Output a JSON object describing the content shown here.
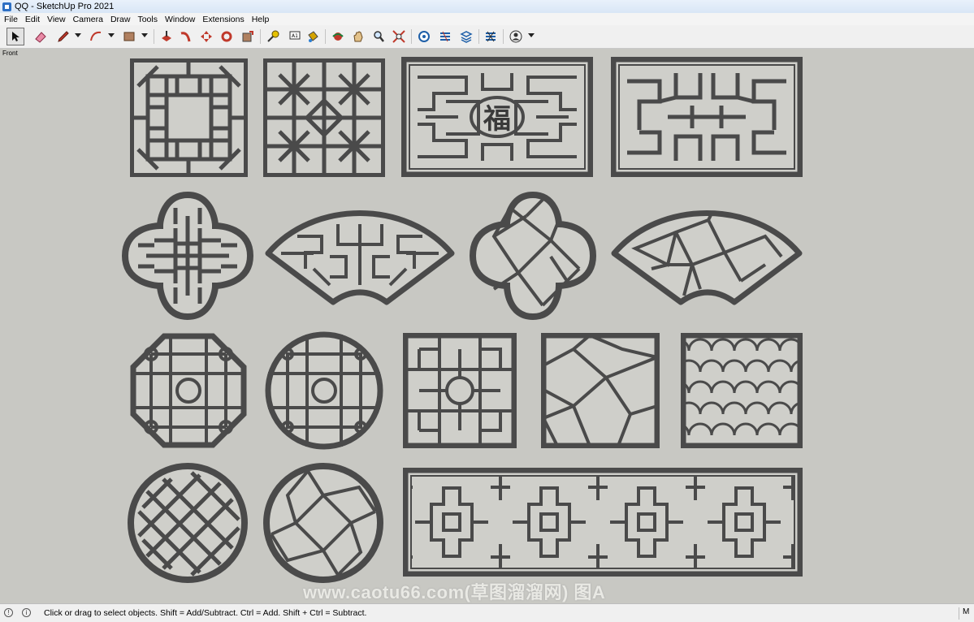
{
  "window": {
    "title": "QQ - SketchUp Pro 2021"
  },
  "menu": {
    "items": [
      "File",
      "Edit",
      "View",
      "Camera",
      "Draw",
      "Tools",
      "Window",
      "Extensions",
      "Help"
    ]
  },
  "toolbar": {
    "tools": [
      "select-tool",
      "eraser-tool",
      "line-tool",
      "arc-tool",
      "shape-tool",
      "push-pull-tool",
      "follow-me-tool",
      "move-tool",
      "rotate-tool",
      "scale-tool",
      "tape-measure-tool",
      "text-tool",
      "paint-bucket-tool",
      "orbit-tool",
      "pan-tool",
      "zoom-tool",
      "zoom-extents-tool",
      "warehouse-tool",
      "extension-warehouse-tool",
      "layout-tool",
      "extension-manager-tool",
      "account-tool"
    ]
  },
  "viewport": {
    "scene_label": "Front",
    "background": "#c8c8c3",
    "frame_color": "#4a4a4a",
    "infill_color": "#cfcfca",
    "panels": [
      "square-lattice-panel-1",
      "square-lattice-panel-2",
      "rect-fu-character-panel",
      "rect-lattice-panel",
      "quatrefoil-lattice-panel",
      "fan-lattice-panel",
      "quatrefoil-ice-crack-panel",
      "fan-ice-crack-panel",
      "octagon-lattice-panel",
      "round-lattice-panel",
      "square-flower-lattice-panel",
      "rect-ice-crack-panel",
      "scale-pattern-panel",
      "round-diagonal-lattice-panel",
      "round-ice-crack-panel",
      "long-rect-lattice-panel"
    ],
    "watermark": "www.caotu66.com(草图溜溜网) 图A"
  },
  "status": {
    "message": "Click or drag to select objects. Shift = Add/Subtract. Ctrl = Add. Shift + Ctrl = Subtract.",
    "right_label": "M"
  }
}
